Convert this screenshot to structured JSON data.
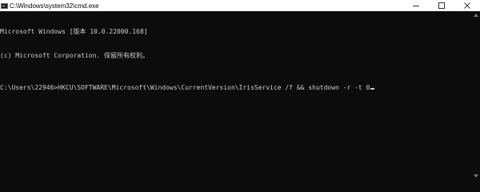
{
  "window": {
    "title": "C:\\Windows\\system32\\cmd.exe"
  },
  "console": {
    "lines": [
      "Microsoft Windows [版本 10.0.22000.168]",
      "(c) Microsoft Corporation. 保留所有权利。"
    ],
    "command_line": "C:\\Users\\22946>HKCU\\SOFTWARE\\Microsoft\\Windows\\CurrentVersion\\IrisService /f && shutdown -r -t 0"
  },
  "icons": {
    "app": "cmd-icon",
    "minimize": "minimize-icon",
    "maximize": "maximize-icon",
    "close": "close-icon",
    "scroll_up": "scroll-up-arrow-icon",
    "scroll_down": "scroll-down-arrow-icon"
  },
  "colors": {
    "console_background": "#0c0c0c",
    "console_text": "#cccccc",
    "titlebar_background": "#ffffff"
  }
}
